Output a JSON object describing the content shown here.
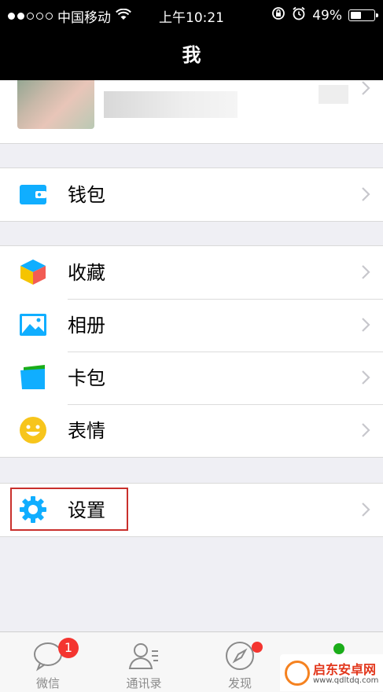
{
  "status_bar": {
    "carrier": "中国移动",
    "time": "上午10:21",
    "battery": "49%",
    "battery_level": 0.49
  },
  "nav": {
    "title": "我"
  },
  "profile": {
    "name_obscured": true
  },
  "menu": {
    "wallet": "钱包",
    "favorites": "收藏",
    "album": "相册",
    "cards": "卡包",
    "stickers": "表情",
    "settings": "设置"
  },
  "tabbar": {
    "chats": "微信",
    "chats_badge": "1",
    "contacts": "通讯录",
    "discover": "发现"
  },
  "watermark": {
    "title": "启东安卓网",
    "url": "www.qdltdq.com"
  },
  "colors": {
    "accent_blue": "#10aeff",
    "badge_red": "#f43530",
    "wechat_green": "#1aad19",
    "highlight_red": "#c9302c"
  }
}
